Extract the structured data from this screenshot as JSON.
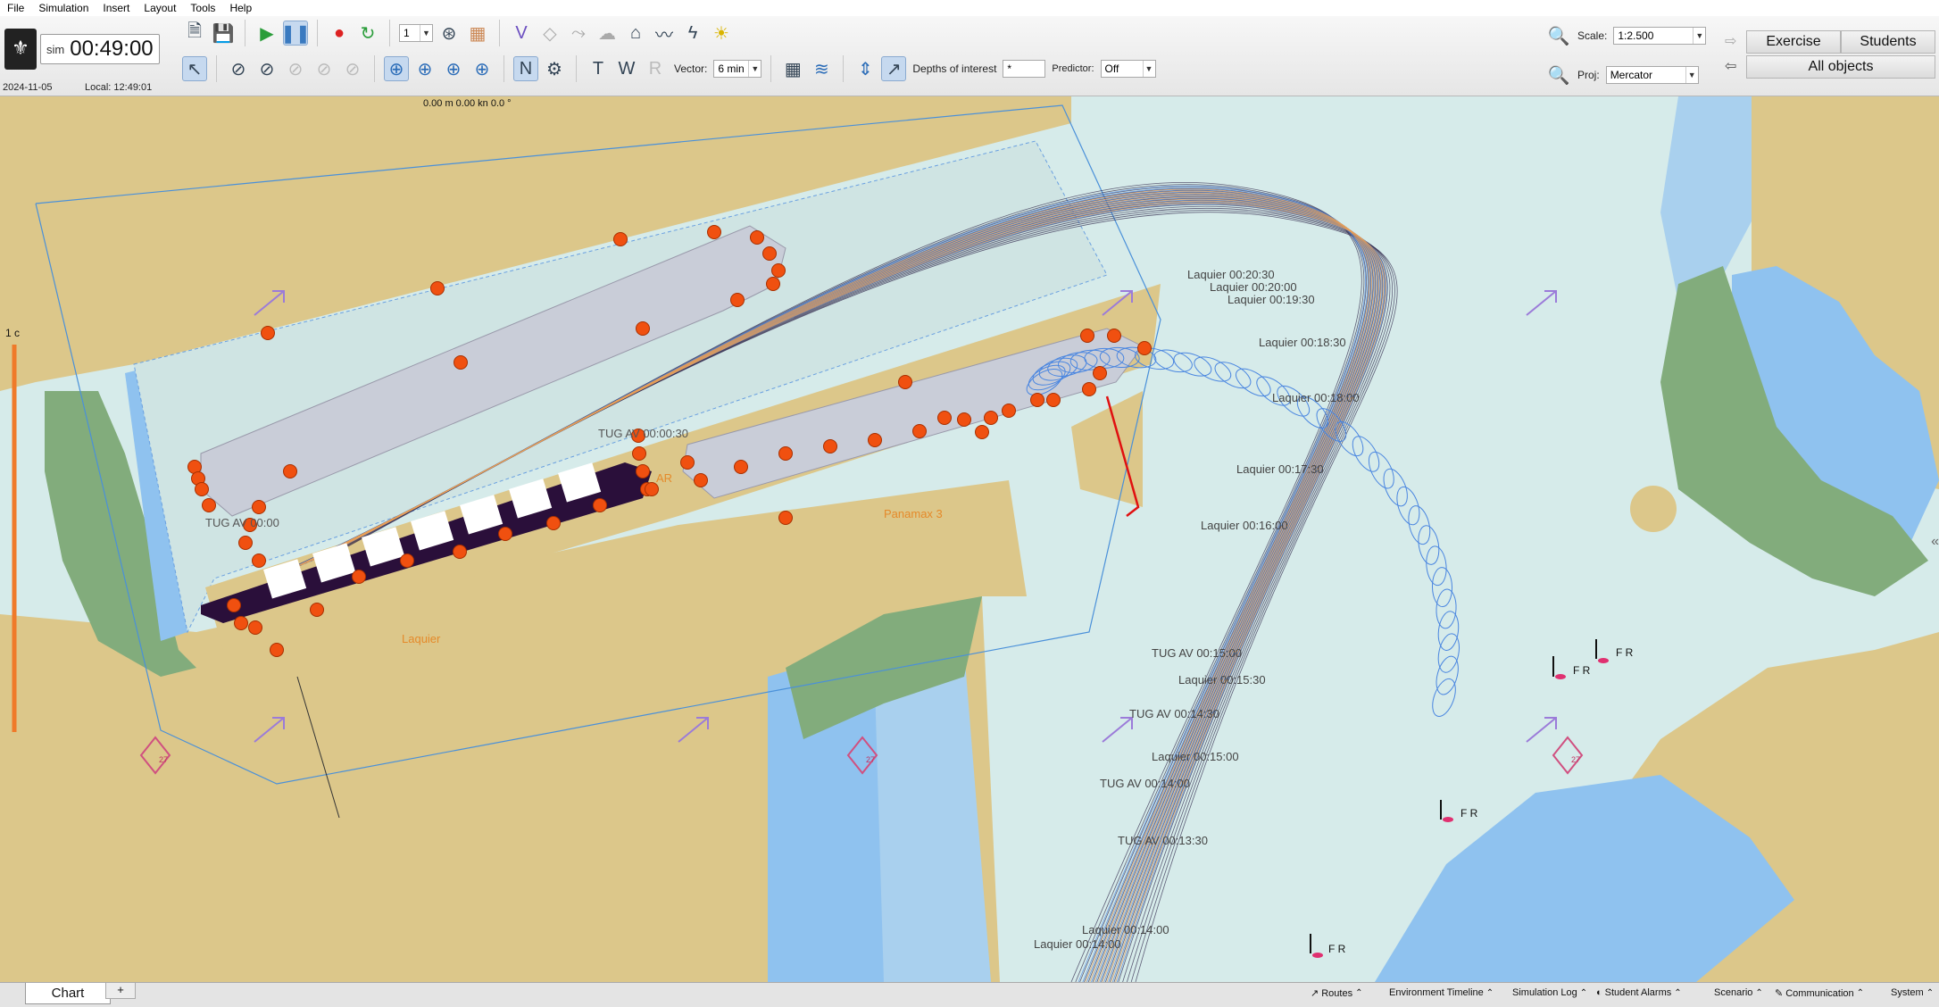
{
  "menu": [
    "File",
    "Simulation",
    "Insert",
    "Layout",
    "Tools",
    "Help"
  ],
  "clock": {
    "sim_label": "sim",
    "sim_time": "00:49:00",
    "date": "2024-11-05",
    "local": "Local:  12:49:01"
  },
  "toolbar": {
    "speed_value": "1",
    "vector_label": "Vector:",
    "vector_value": "6 min",
    "depths_label": "Depths of interest",
    "depths_value": "*",
    "predictor_label": "Predictor:",
    "predictor_value": "Off",
    "scale_label": "Scale:",
    "scale_value": "1:2.500",
    "proj_label": "Proj:",
    "proj_value": "Mercator"
  },
  "right_panel": {
    "exercise": "Exercise",
    "students": "Students",
    "all_objects": "All objects"
  },
  "map": {
    "readout": "0.00 m   0.00 kn   0.0 °",
    "left_scale_label": "1 c",
    "labels": {
      "panamax": "Panamax 3",
      "laquier": "Laquier",
      "tug_left": "TUG AV 00:00",
      "tug_top": "TUG AV 00:00:30",
      "ar": "AR",
      "l1": "Laquier 00:20:30",
      "l2": "Laquier 00:20:00",
      "l3": "Laquier 00:19:30",
      "l4": "Laquier 00:18:30",
      "l5": "Laquier 00:18:00",
      "l6": "Laquier 00:17:30",
      "l7": "Laquier 00:16:00",
      "l8": "TUG AV 00:15:00",
      "l9": "Laquier 00:15:30",
      "l10": "TUG AV 00:14:30",
      "l11": "Laquier 00:15:00",
      "l12": "TUG AV 00:14:00",
      "l13": "TUG AV 00:13:30",
      "l14": "Laquier 00:14:00"
    },
    "buoy_label": "F R",
    "depth_mark": "27"
  },
  "bottom": {
    "chart_tab": "Chart",
    "plus_tab": "+",
    "items": [
      "Routes",
      "Environment Timeline",
      "Simulation Log",
      "Student Alarms",
      "Scenario",
      "Communication",
      "System"
    ]
  },
  "colors": {
    "land": "#dcc78a",
    "water": "#d6ebea",
    "deep_water": "#8fc2ef",
    "green": "#82ac7c",
    "ship": "#c9cdd8",
    "fender": "#f05010",
    "own_ship": "#2a0f3a"
  }
}
